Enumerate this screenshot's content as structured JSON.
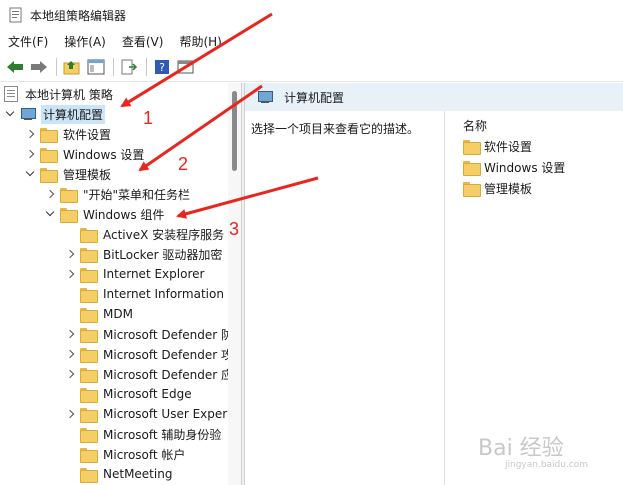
{
  "window": {
    "title": "本地组策略编辑器"
  },
  "menu": [
    {
      "label": "文件(F)"
    },
    {
      "label": "操作(A)"
    },
    {
      "label": "查看(V)"
    },
    {
      "label": "帮助(H)"
    }
  ],
  "toolbar": {
    "icons": [
      "back-arrow-icon",
      "forward-arrow-icon",
      "up-folder-icon",
      "show-hide-tree-icon",
      "export-list-icon",
      "help-icon",
      "properties-icon"
    ]
  },
  "tree": {
    "root": "本地计算机 策略",
    "items": [
      {
        "label": "计算机配置",
        "level": 1,
        "chevron": "down",
        "icon": "computer",
        "selected": true
      },
      {
        "label": "软件设置",
        "level": 2,
        "chevron": "right",
        "icon": "folder"
      },
      {
        "label": "Windows 设置",
        "level": 2,
        "chevron": "right",
        "icon": "folder"
      },
      {
        "label": "管理模板",
        "level": 2,
        "chevron": "down",
        "icon": "folder"
      },
      {
        "label": "\"开始\"菜单和任务栏",
        "level": 3,
        "chevron": "right",
        "icon": "folder"
      },
      {
        "label": "Windows 组件",
        "level": 3,
        "chevron": "down",
        "icon": "folder"
      },
      {
        "label": "ActiveX 安装程序服务",
        "level": 4,
        "chevron": "none",
        "icon": "folder"
      },
      {
        "label": "BitLocker 驱动器加密",
        "level": 4,
        "chevron": "right",
        "icon": "folder"
      },
      {
        "label": "Internet Explorer",
        "level": 4,
        "chevron": "right",
        "icon": "folder"
      },
      {
        "label": "Internet Information",
        "level": 4,
        "chevron": "none",
        "icon": "folder"
      },
      {
        "label": "MDM",
        "level": 4,
        "chevron": "none",
        "icon": "folder"
      },
      {
        "label": "Microsoft Defender 防",
        "level": 4,
        "chevron": "right",
        "icon": "folder"
      },
      {
        "label": "Microsoft Defender 攻",
        "level": 4,
        "chevron": "right",
        "icon": "folder"
      },
      {
        "label": "Microsoft Defender 应",
        "level": 4,
        "chevron": "right",
        "icon": "folder"
      },
      {
        "label": "Microsoft Edge",
        "level": 4,
        "chevron": "none",
        "icon": "folder"
      },
      {
        "label": "Microsoft User Exper",
        "level": 4,
        "chevron": "none",
        "icon": "folder"
      },
      {
        "label": "Microsoft 辅助身份验",
        "level": 4,
        "chevron": "none",
        "icon": "folder"
      },
      {
        "label": "Microsoft 帐户",
        "level": 4,
        "chevron": "none",
        "icon": "folder"
      },
      {
        "label": "NetMeeting",
        "level": 4,
        "chevron": "none",
        "icon": "folder"
      }
    ]
  },
  "right": {
    "header": "计算机配置",
    "description": "选择一个项目来查看它的描述。",
    "column_header": "名称",
    "items": [
      {
        "label": "软件设置"
      },
      {
        "label": "Windows 设置"
      },
      {
        "label": "管理模板"
      }
    ]
  },
  "annotations": [
    {
      "label": "1"
    },
    {
      "label": "2"
    },
    {
      "label": "3"
    }
  ],
  "annotation_color": "#e8261e",
  "watermark": {
    "text": "Bai 经验",
    "sub": "jingyan.baidu.com"
  }
}
